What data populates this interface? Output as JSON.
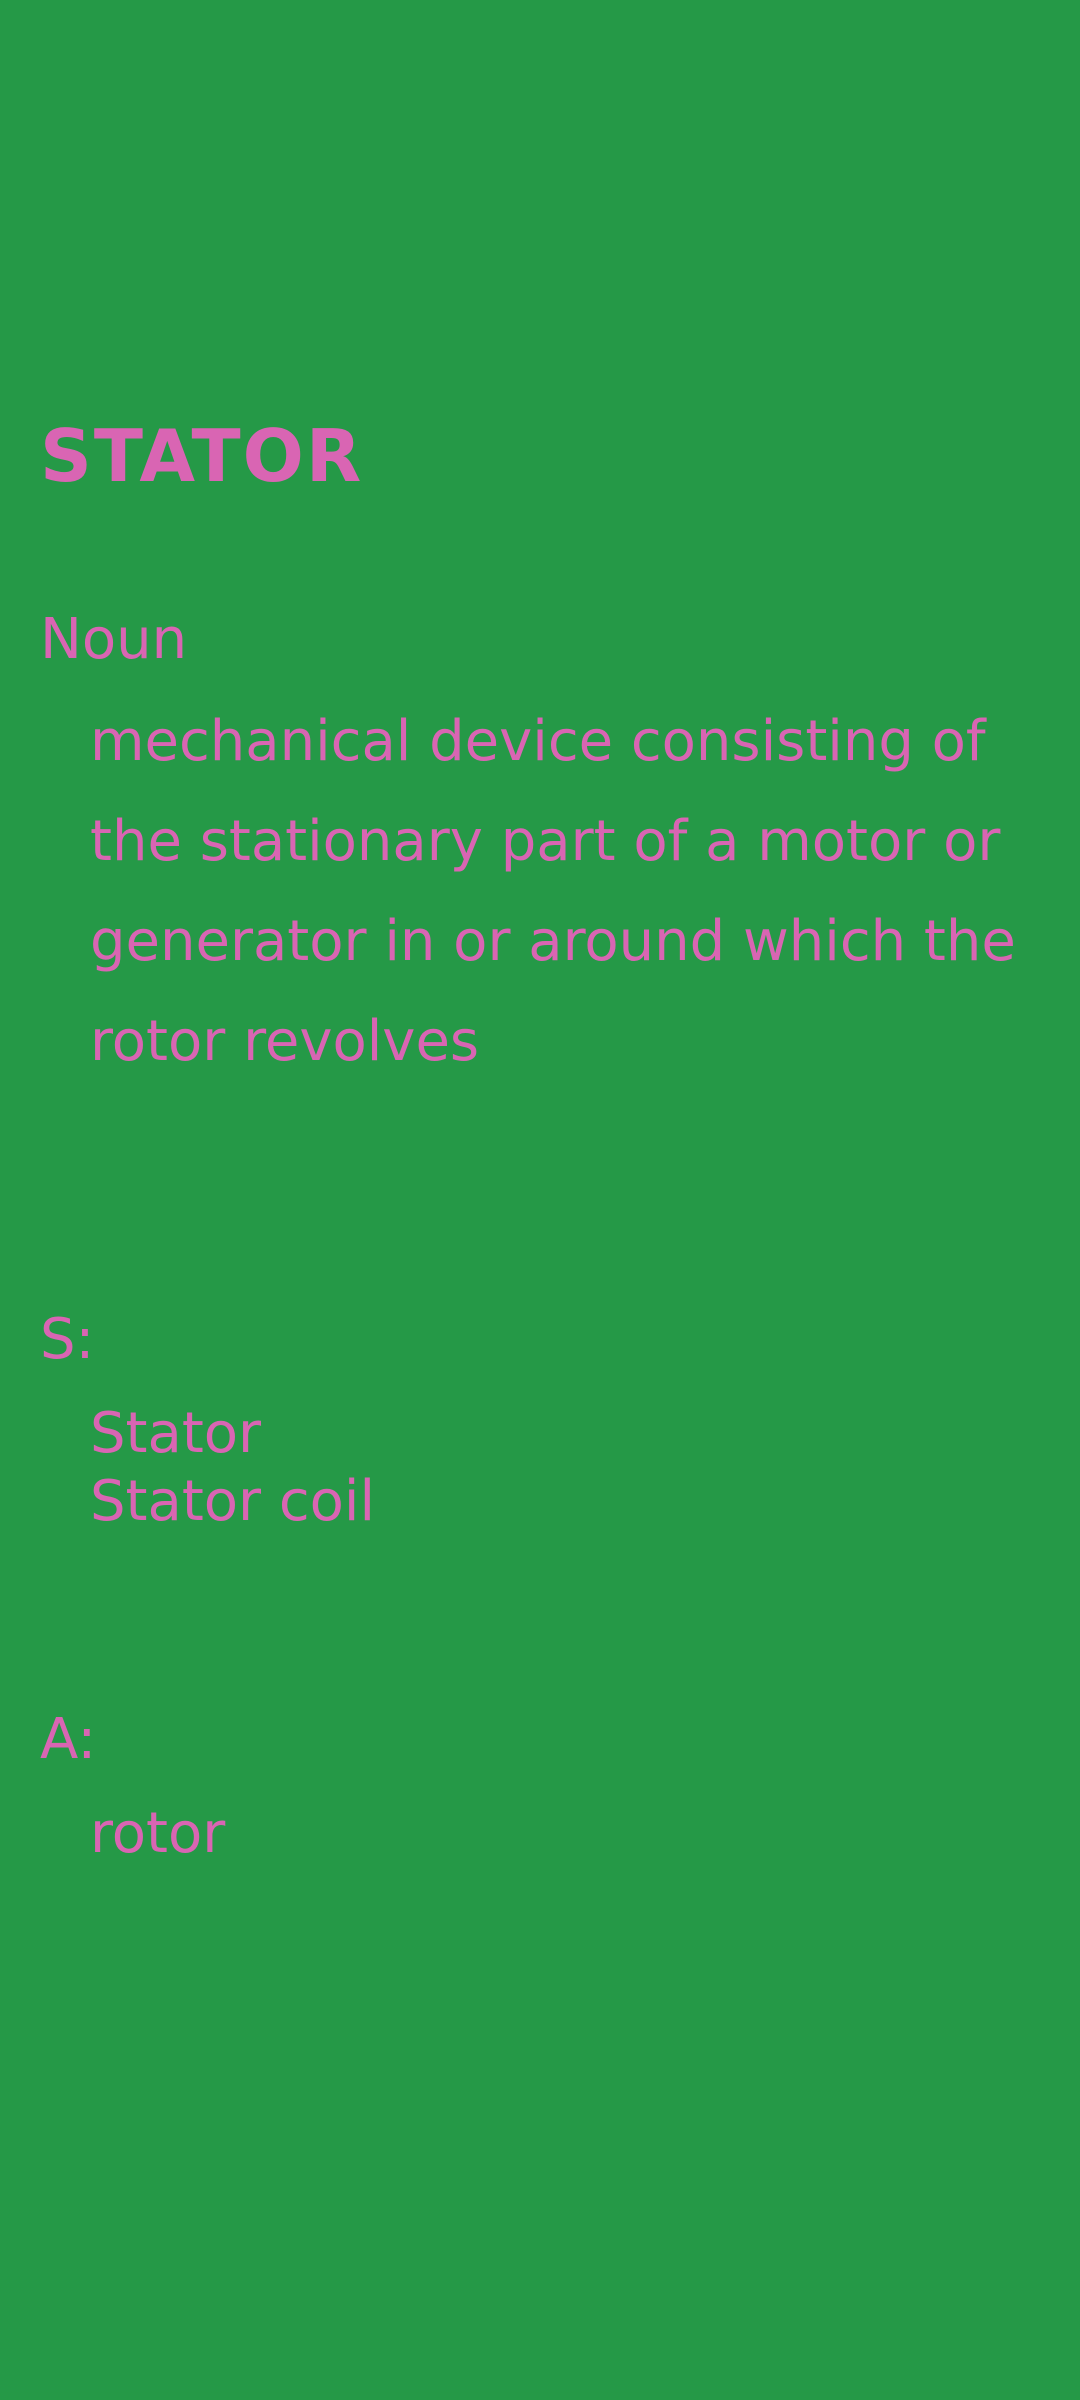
{
  "entry": {
    "word": "STATOR",
    "part_of_speech": "Noun",
    "definition": "mechanical device consisting of the stationary part of a motor or generator in or around which the rotor revolves"
  },
  "synonyms": {
    "label": "S:",
    "items": [
      "Stator",
      "Stator coil"
    ]
  },
  "antonyms": {
    "label": "A:",
    "items": [
      "rotor"
    ]
  },
  "colors": {
    "background": "#259947",
    "text": "#d965b3"
  }
}
